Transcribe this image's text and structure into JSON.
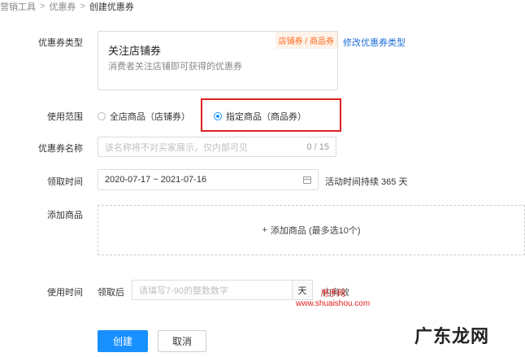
{
  "breadcrumb": {
    "items": [
      "营销工具",
      "优惠券",
      "创建优惠券"
    ],
    "separator": ">"
  },
  "coupon_type": {
    "label": "优惠券类型",
    "card_title": "关注店铺券",
    "card_desc": "消费者关注店铺即可获得的优惠券",
    "tag": "店铺券 / 商品券",
    "change_link": "修改优惠券类型"
  },
  "scope": {
    "label": "使用范围",
    "options": [
      "全店商品（店铺券）",
      "指定商品（商品券）"
    ],
    "selected_index": 1
  },
  "coupon_name": {
    "label": "优惠券名称",
    "placeholder": "该名称将不对买家展示，仅内部可见",
    "count": "0 / 15"
  },
  "receive_time": {
    "label": "领取时间",
    "value": "2020-07-17 ~ 2021-07-16",
    "duration": "活动时间持续 365 天"
  },
  "add_goods": {
    "label": "添加商品",
    "button": "添加商品 (最多选10个)",
    "plus": "+"
  },
  "use_time": {
    "label": "使用时间",
    "prefix": "领取后",
    "placeholder": "请填写7-90的整数数字",
    "suffix": "天",
    "trailing": "内有效"
  },
  "watermark": {
    "small_line1": "甩手网",
    "small_line2": "www.shuaishou.com",
    "big": "广东龙网"
  },
  "actions": {
    "create": "创建",
    "cancel": "取消"
  },
  "colors": {
    "primary": "#1890ff",
    "tag_text": "#ff6a1f",
    "tag_bg": "#fff2e8",
    "link": "#1e6fd9",
    "highlight": "#e02020"
  }
}
